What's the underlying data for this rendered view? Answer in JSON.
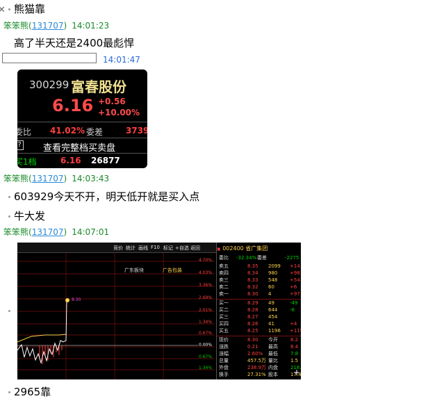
{
  "messages": [
    {
      "type": "text",
      "text": "熊猫靠"
    },
    {
      "type": "header",
      "user": "笨笨熊",
      "uid": "131707",
      "time": "14:01:23"
    },
    {
      "type": "text",
      "text": "高了半天还是2400最彪悍"
    },
    {
      "type": "time_only",
      "time": "14:01:47"
    },
    {
      "type": "header",
      "user": "笨笨熊",
      "uid": "131707",
      "time": "14:03:43"
    },
    {
      "type": "text",
      "text": "603929今天不开，明天低开就是买入点"
    },
    {
      "type": "text",
      "text": "牛大发"
    },
    {
      "type": "header",
      "user": "笨笨熊",
      "uid": "131707",
      "time": "14:07:01"
    },
    {
      "type": "text",
      "text": "2965靠"
    }
  ],
  "quote_card": {
    "code": "300299",
    "name": "富春股份",
    "price": "6.16",
    "change": "+0.56",
    "change_pct": "+10.00%",
    "weibi_label": "委比",
    "weibi_value": "41.02%",
    "weicha_label": "委差",
    "weicha_value": "3739",
    "link_text": "查看完整档买卖盘",
    "buy1_label": "买1档",
    "buy1_price": "6.16",
    "buy1_volume": "26877",
    "colors": {
      "price": "#ff4b4b",
      "name": "#f0e090"
    }
  },
  "trade_screen": {
    "toolbar": [
      "竞价",
      "统计",
      "画线",
      "F10",
      "标记",
      "+自选",
      "返回"
    ],
    "board_labels": [
      "广东板块",
      "广告包装"
    ],
    "mark_label": "8.30",
    "pct_labels": [
      "4.70%",
      "4.03%",
      "3.36%",
      "2.69%",
      "2.01%",
      "1.34%",
      "0.67%",
      "0.00%",
      "0.67%",
      "1.34%"
    ],
    "title": "002400 省广集团",
    "weibi": {
      "label": "委比",
      "value": "-32.34%",
      "label2": "委差",
      "value2": "-2275"
    },
    "sells": [
      {
        "label": "卖五",
        "price": "8.35",
        "vol": "2099",
        "extra": "+14"
      },
      {
        "label": "卖四",
        "price": "8.34",
        "vol": "980",
        "extra": "+98"
      },
      {
        "label": "卖三",
        "price": "8.33",
        "vol": "548",
        "extra": "+54"
      },
      {
        "label": "卖二",
        "price": "8.32",
        "vol": "60",
        "extra": "+6"
      },
      {
        "label": "卖一",
        "price": "8.30",
        "vol": "4",
        "extra": "+97"
      }
    ],
    "buys": [
      {
        "label": "买一",
        "price": "8.29",
        "vol": "49",
        "extra": "-49"
      },
      {
        "label": "买二",
        "price": "8.28",
        "vol": "644",
        "extra": "-6"
      },
      {
        "label": "买三",
        "price": "8.27",
        "vol": "454",
        "extra": ""
      },
      {
        "label": "买四",
        "price": "8.26",
        "vol": "41",
        "extra": "+4"
      },
      {
        "label": "买五",
        "price": "8.25",
        "vol": "1196",
        "extra": "+119"
      }
    ],
    "stats": [
      {
        "l1": "现价",
        "v1": "8.30",
        "l2": "今开",
        "v2": "8.2"
      },
      {
        "l1": "涨跌",
        "v1": "0.21",
        "l2": "最高",
        "v2": "8.4"
      },
      {
        "l1": "涨幅",
        "v1": "2.60%",
        "l2": "最低",
        "v2": "7.8"
      },
      {
        "l1": "总量",
        "v1": "457.5万",
        "l2": "量比",
        "v2": "1.5"
      },
      {
        "l1": "外盘",
        "v1": "238.9万",
        "l2": "内盘",
        "v2": "218."
      },
      {
        "l1": "换手",
        "v1": "27.31%",
        "l2": "股本",
        "v2": "17.4"
      }
    ]
  },
  "ui": {
    "close_glyph": "✕",
    "input_value": ""
  }
}
